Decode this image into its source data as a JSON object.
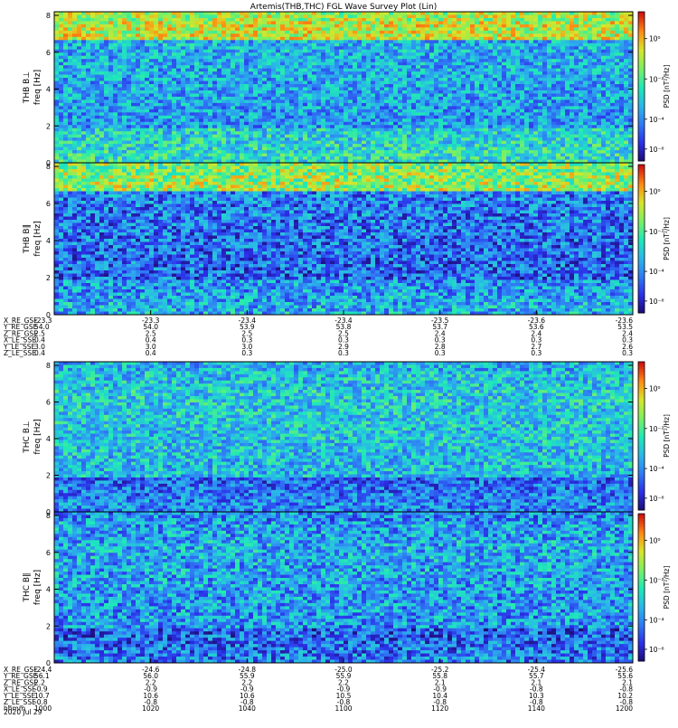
{
  "figure": {
    "title": "Artemis(THB,THC) FGL Wave Survey Plot (Lin)",
    "date_label": "2020 Jul 29"
  },
  "colormap": [
    "#1c0a6c",
    "#2b2ee8",
    "#2f79f5",
    "#2ab7e9",
    "#1ee9b8",
    "#7bf062",
    "#d6e62a",
    "#ff8a12",
    "#d01212"
  ],
  "chart_data": [
    {
      "type": "heatmap",
      "id": "thb-b-perp",
      "ylabel_line1": "THB B⊥",
      "ylabel_line2": "freq [Hz]",
      "yticks": [
        "0",
        "2",
        "4",
        "6",
        "8"
      ],
      "ylim": [
        0,
        8
      ],
      "colorbar_label": "PSD [nT²/Hz]",
      "colorbar_ticks": [
        "10⁰",
        "10⁻²",
        "10⁻⁴",
        "10⁻⁶"
      ],
      "scale": "log",
      "level": {
        "base": 0.34,
        "top_band": 0.72,
        "low_band": 0.42,
        "noise": 0.18
      }
    },
    {
      "type": "heatmap",
      "id": "thb-b-par",
      "ylabel_line1": "THB B∥",
      "ylabel_line2": "freq [Hz]",
      "yticks": [
        "0",
        "2",
        "4",
        "6",
        "8"
      ],
      "ylim": [
        0,
        8
      ],
      "colorbar_label": "PSD [nT²/Hz]",
      "colorbar_ticks": [
        "10⁰",
        "10⁻²",
        "10⁻⁴",
        "10⁻⁶"
      ],
      "scale": "log",
      "level": {
        "base": 0.24,
        "top_band": 0.66,
        "low_band": 0.3,
        "noise": 0.2
      }
    },
    {
      "type": "heatmap",
      "id": "thc-b-perp",
      "ylabel_line1": "THC B⊥",
      "ylabel_line2": "freq [Hz]",
      "yticks": [
        "0",
        "2",
        "4",
        "6",
        "8"
      ],
      "ylim": [
        0,
        8
      ],
      "colorbar_label": "PSD [nT²/Hz]",
      "colorbar_ticks": [
        "10⁰",
        "10⁻²",
        "10⁻⁴",
        "10⁻⁶"
      ],
      "scale": "log",
      "level": {
        "base": 0.4,
        "top_band": 0.4,
        "low_band": 0.22,
        "noise": 0.18
      }
    },
    {
      "type": "heatmap",
      "id": "thc-b-par",
      "ylabel_line1": "THC B∥",
      "ylabel_line2": "freq [Hz]",
      "yticks": [
        "0",
        "2",
        "4",
        "6",
        "8"
      ],
      "ylim": [
        0,
        8
      ],
      "colorbar_label": "PSD [nT²/Hz]",
      "colorbar_ticks": [
        "10⁰",
        "10⁻²",
        "10⁻⁴",
        "10⁻⁶"
      ],
      "scale": "log",
      "level": {
        "base": 0.33,
        "top_band": 0.33,
        "low_band": 0.2,
        "noise": 0.2
      }
    }
  ],
  "ephemeris_thb": {
    "columns": 7,
    "rows": [
      {
        "label": "X_RE_GSE",
        "values": [
          "-23.3",
          "-23.3",
          "-23.4",
          "-23.4",
          "-23.5",
          "-23.6",
          "-23.6"
        ]
      },
      {
        "label": "Y_RE_GSE",
        "values": [
          "54.0",
          "54.0",
          "53.9",
          "53.8",
          "53.7",
          "53.6",
          "53.5"
        ]
      },
      {
        "label": "Z_RE_GSE",
        "values": [
          "2.5",
          "2.5",
          "2.5",
          "2.5",
          "2.4",
          "2.4",
          "2.4"
        ]
      },
      {
        "label": "X_LE_SSE",
        "values": [
          "0.4",
          "0.4",
          "0.3",
          "0.3",
          "0.3",
          "0.3",
          "0.3"
        ]
      },
      {
        "label": "Y_LE_SSE",
        "values": [
          "3.0",
          "3.0",
          "3.0",
          "2.9",
          "2.8",
          "2.7",
          "2.6"
        ]
      },
      {
        "label": "Z_LE_SSE",
        "values": [
          "0.4",
          "0.4",
          "0.3",
          "0.3",
          "0.3",
          "0.3",
          "0.3"
        ]
      }
    ]
  },
  "ephemeris_thc": {
    "columns": 7,
    "rows": [
      {
        "label": "X_RE_GSE",
        "values": [
          "-24.4",
          "-24.6",
          "-24.8",
          "-25.0",
          "-25.2",
          "-25.4",
          "-25.6"
        ]
      },
      {
        "label": "Y_RE_GSE",
        "values": [
          "56.1",
          "56.0",
          "55.9",
          "55.9",
          "55.8",
          "55.7",
          "55.6"
        ]
      },
      {
        "label": "Z_RE_GSE",
        "values": [
          "2.2",
          "2.2",
          "2.2",
          "2.2",
          "2.1",
          "2.1",
          "2.1"
        ]
      },
      {
        "label": "X_LE_SSE",
        "values": [
          "-0.9",
          "-0.9",
          "-0.9",
          "-0.9",
          "-0.9",
          "-0.8",
          "-0.8"
        ]
      },
      {
        "label": "Y_LE_SSE",
        "values": [
          "10.7",
          "10.6",
          "10.6",
          "10.5",
          "10.4",
          "10.3",
          "10.2"
        ]
      },
      {
        "label": "Z_LE_SSE",
        "values": [
          "-0.8",
          "-0.8",
          "-0.8",
          "-0.8",
          "-0.8",
          "-0.8",
          "-0.8"
        ]
      },
      {
        "label": "hhmm",
        "values": [
          "1000",
          "1020",
          "1040",
          "1100",
          "1120",
          "1140",
          "1200"
        ]
      }
    ]
  }
}
